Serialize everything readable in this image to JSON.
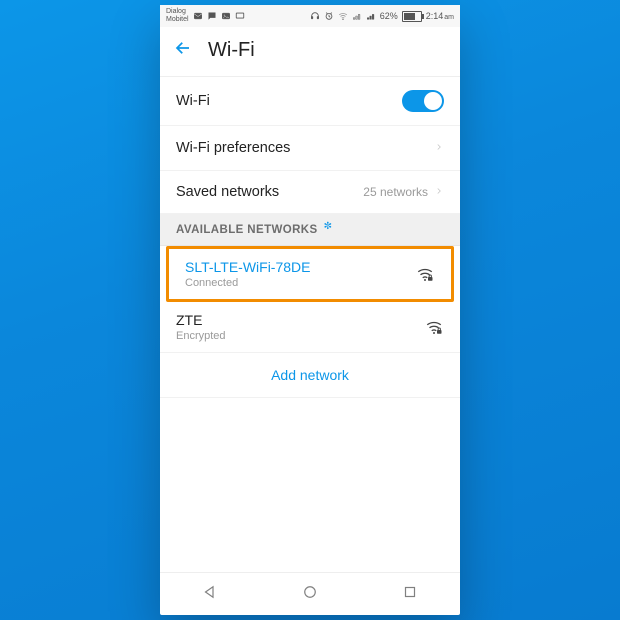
{
  "statusbar": {
    "carrier_line1": "Dialog",
    "carrier_line2": "Mobitel",
    "battery_pct": "62%",
    "time": "2:14",
    "ampm": "am"
  },
  "header": {
    "title": "Wi-Fi"
  },
  "toggle_row": {
    "label": "Wi-Fi",
    "on": true
  },
  "prefs_row": {
    "label": "Wi-Fi preferences"
  },
  "saved_row": {
    "label": "Saved networks",
    "value": "25 networks"
  },
  "section": {
    "label": "AVAILABLE NETWORKS"
  },
  "networks": [
    {
      "name": "SLT-LTE-WiFi-78DE",
      "sub": "Connected",
      "secured": true,
      "connected": true
    },
    {
      "name": "ZTE",
      "sub": "Encrypted",
      "secured": true,
      "connected": false
    }
  ],
  "add_network": {
    "label": "Add network"
  }
}
